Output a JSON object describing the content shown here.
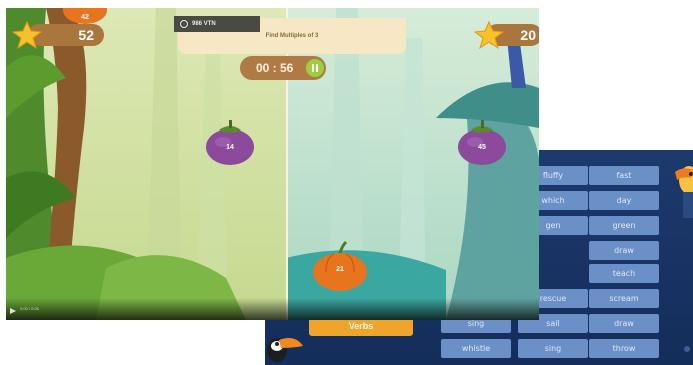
{
  "front_game": {
    "instruction": "Find Multiples of 3",
    "tab_label": "986 VTN",
    "score_left": "52",
    "score_right": "20",
    "top_fruit_number": "42",
    "timer": "00 : 56",
    "video_time": "0:00 / 0:06",
    "fruits": [
      {
        "type": "mangosteen",
        "number": "14"
      },
      {
        "type": "mangosteen",
        "number": "45"
      },
      {
        "type": "pumpkin",
        "number": "21"
      }
    ],
    "colors": {
      "score_bg": "#a9763e",
      "pause": "#9ccf3d",
      "banner": "#f6e8c4"
    }
  },
  "back_game": {
    "verbs_button": "Verbs",
    "words": [
      "fluffy",
      "fast",
      "which",
      "day",
      "gen",
      "green",
      "draw",
      "teach",
      "rescue",
      "scream",
      "sing",
      "sail",
      "draw",
      "whistle",
      "sing",
      "throw"
    ]
  }
}
